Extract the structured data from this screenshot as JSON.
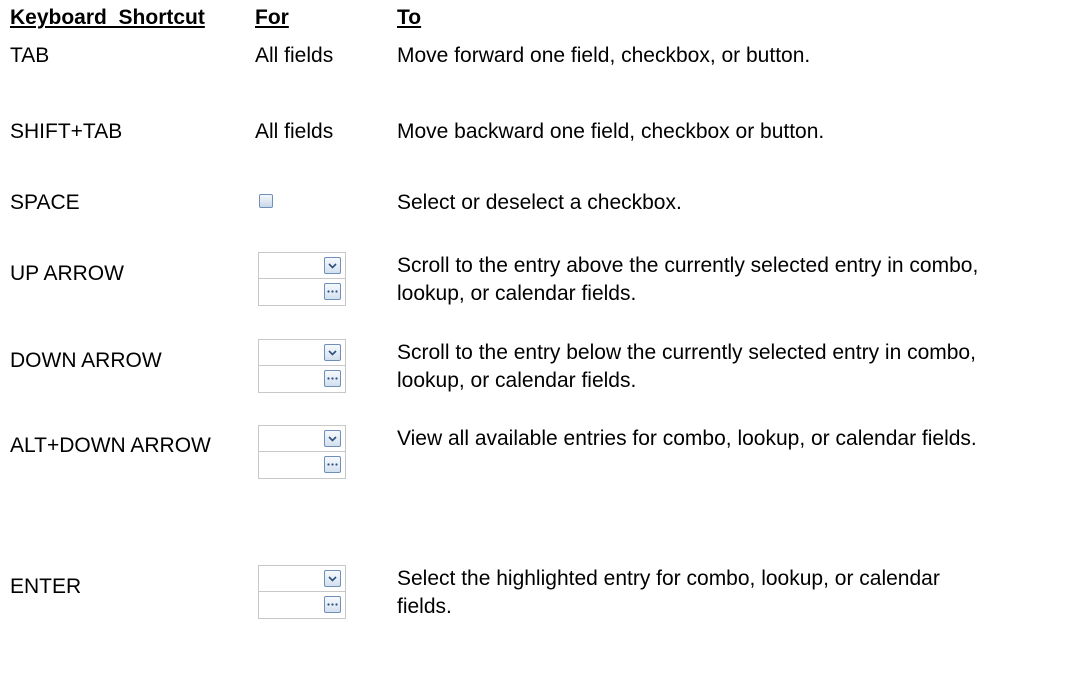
{
  "headers": {
    "shortcut": "Keyboard  Shortcut",
    "for": "For",
    "to": "To"
  },
  "rows": [
    {
      "shortcut": "TAB",
      "for": "All fields",
      "to": "Move forward one field, checkbox, or button."
    },
    {
      "shortcut": "SHIFT+TAB",
      "for": "All fields",
      "to": "Move backward one field, checkbox or button."
    },
    {
      "shortcut": "SPACE",
      "for_icon": "checkbox-icon",
      "to": "Select or deselect a checkbox."
    },
    {
      "shortcut": "UP ARROW",
      "for_icon": "combo-lookup-field-icon",
      "to": "Scroll to the entry above the currently selected entry in combo, lookup, or calendar fields."
    },
    {
      "shortcut": "DOWN ARROW",
      "for_icon": "combo-lookup-field-icon",
      "to": "Scroll to the entry below the currently selected entry in combo, lookup, or calendar fields."
    },
    {
      "shortcut": "ALT+DOWN ARROW",
      "for_icon": "combo-lookup-field-icon",
      "to": "View all available entries for combo, lookup, or calendar fields."
    },
    {
      "shortcut": "ENTER",
      "for_icon": "combo-lookup-field-icon",
      "to": "Select the highlighted entry for combo, lookup, or calendar fields."
    }
  ]
}
